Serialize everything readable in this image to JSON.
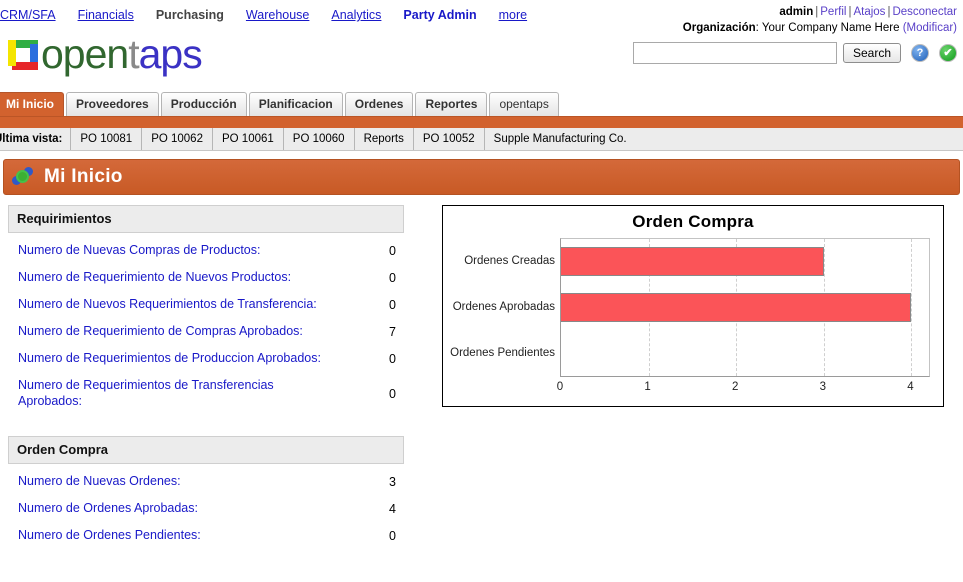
{
  "topnav": {
    "links": [
      {
        "label": "CRM/SFA",
        "style": "link"
      },
      {
        "label": "Financials",
        "style": "link"
      },
      {
        "label": "Purchasing",
        "style": "current"
      },
      {
        "label": "Warehouse",
        "style": "link"
      },
      {
        "label": "Analytics",
        "style": "link"
      },
      {
        "label": "Party Admin",
        "style": "bold-link"
      },
      {
        "label": "more",
        "style": "link"
      }
    ]
  },
  "userinfo": {
    "user": "admin",
    "profile": "Perfil",
    "shortcuts": "Atajos",
    "logout": "Desconectar",
    "org_label": "Organización",
    "org_name": "Your Company Name Here",
    "org_edit": "(Modificar)",
    "separator": "|"
  },
  "logo": {
    "part1": "open",
    "part2": "t",
    "part3": "aps"
  },
  "search": {
    "value": "",
    "placeholder": "",
    "button": "Search",
    "help_icon": "?",
    "status_icon": "✔"
  },
  "tabs": [
    {
      "label": "Mi Inicio",
      "active": true,
      "plain": false
    },
    {
      "label": "Proveedores",
      "active": false,
      "plain": false
    },
    {
      "label": "Producción",
      "active": false,
      "plain": false
    },
    {
      "label": "Planificacion",
      "active": false,
      "plain": false
    },
    {
      "label": "Ordenes",
      "active": false,
      "plain": false
    },
    {
      "label": "Reportes",
      "active": false,
      "plain": false
    },
    {
      "label": "opentaps",
      "active": false,
      "plain": true
    }
  ],
  "lastview": {
    "label": "Ultima vista:",
    "items": [
      "PO 10081",
      "PO 10062",
      "PO 10061",
      "PO 10060",
      "Reports",
      "PO 10052",
      "Supple Manufacturing Co."
    ]
  },
  "pagehead": {
    "title": "Mi Inicio"
  },
  "panels": [
    {
      "title": "Requirimientos",
      "rows": [
        {
          "label": "Numero de Nuevas Compras de Productos:",
          "value": "0",
          "twoline": false
        },
        {
          "label": "Numero de Requerimiento de Nuevos Productos:",
          "value": "0",
          "twoline": false
        },
        {
          "label": "Numero de Nuevos Requerimientos de Transferencia:",
          "value": "0",
          "twoline": false
        },
        {
          "label": "Numero de Requerimiento de Compras Aprobados:",
          "value": "7",
          "twoline": false
        },
        {
          "label": "Numero de Requerimientos de Produccion Aprobados:",
          "value": "0",
          "twoline": false
        },
        {
          "label": "Numero de Requerimientos de Transferencias Aprobados:",
          "value": "0",
          "twoline": true
        }
      ]
    },
    {
      "title": "Orden Compra",
      "rows": [
        {
          "label": "Numero de Nuevas Ordenes:",
          "value": "3",
          "twoline": false
        },
        {
          "label": "Numero de Ordenes Aprobadas:",
          "value": "4",
          "twoline": false
        },
        {
          "label": "Numero de Ordenes Pendientes:",
          "value": "0",
          "twoline": false
        }
      ]
    }
  ],
  "chart_data": {
    "type": "bar",
    "orientation": "horizontal",
    "title": "Orden Compra",
    "categories": [
      "Ordenes Creadas",
      "Ordenes Aprobadas",
      "Ordenes Pendientes"
    ],
    "values": [
      3,
      4,
      0
    ],
    "xlabel": "",
    "ylabel": "",
    "xlim": [
      0,
      4.2
    ],
    "xticks": [
      0,
      1,
      2,
      3,
      4
    ],
    "xtick_labels": [
      "0",
      "1",
      "2",
      "3",
      "4"
    ],
    "grid": true,
    "legend": false,
    "bar_color": "#fb5458",
    "bar_border_color": "#888888"
  },
  "colors": {
    "accent_orange": "#d2622e",
    "link_blue": "#1818c8",
    "panel_header_gray": "#ececec"
  }
}
